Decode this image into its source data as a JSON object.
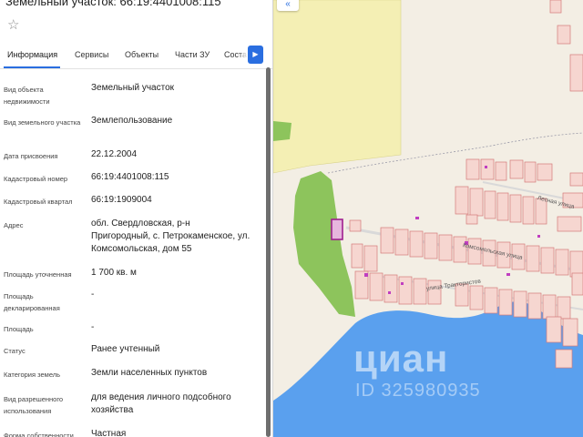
{
  "panel": {
    "title": "Земельный участок: 66:19:4401008:115",
    "star_icon": "star-icon",
    "tabs": [
      {
        "label": "Информация",
        "active": true
      },
      {
        "label": "Сервисы",
        "active": false
      },
      {
        "label": "Объекты",
        "active": false
      },
      {
        "label": "Части ЗУ",
        "active": false
      },
      {
        "label": "Соста",
        "active": false
      }
    ],
    "tabs_next_icon": "chevron-right-icon",
    "rows": [
      {
        "label": "Вид объекта недвижимости",
        "value": "Земельный участок"
      },
      {
        "label": "Вид земельного участка",
        "value": "Землепользование"
      },
      {
        "label": "Дата присвоения",
        "value": "22.12.2004"
      },
      {
        "label": "Кадастровый номер",
        "value": "66:19:4401008:115"
      },
      {
        "label": "Кадастровый квартал",
        "value": "66:19:1909004"
      },
      {
        "label": "Адрес",
        "value": "обл. Свердловская, р-н Пригородный, с. Петрокаменское, ул. Комсомольская, дом 55"
      },
      {
        "label": "Площадь уточненная",
        "value": "1 700 кв. м"
      },
      {
        "label": "Площадь декларированная",
        "value": "-"
      },
      {
        "label": "Площадь",
        "value": "-"
      },
      {
        "label": "Статус",
        "value": "Ранее учтенный"
      },
      {
        "label": "Категория земель",
        "value": "Земли населенных пунктов"
      },
      {
        "label": "Вид разрешенного использования",
        "value": "для ведения личного подсобного хозяйства"
      },
      {
        "label": "Форма собственности",
        "value": "Частная"
      }
    ]
  },
  "map": {
    "back_icon": "chevron-left-icon",
    "streets": [
      "Лесная улица",
      "Комсомольская улица",
      "улица Трактористов"
    ],
    "watermark": "циан",
    "watermark_id": "ID 325980935",
    "colors": {
      "water": "#5aa0ee",
      "forest": "#8dc45c",
      "field": "#f4efb4",
      "parcel_fill": "#f6d6d0",
      "parcel_stroke": "#d47a7a",
      "selected": "#a0208f"
    }
  }
}
